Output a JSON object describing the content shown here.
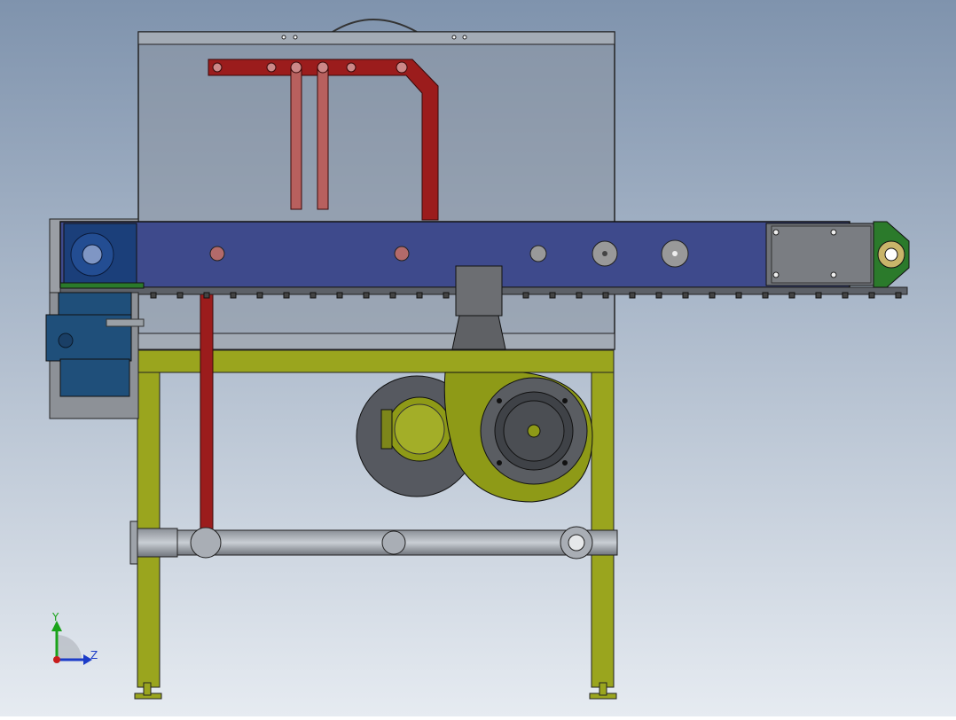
{
  "viewport": {
    "background_top": "#7f93ad",
    "background_bottom": "#e6ebf1",
    "model": {
      "frame_color": "#9aa51e",
      "conveyor_color": "#3e4a8c",
      "pipe_color": "#9b1c1c",
      "housing_color": "#8c96a3",
      "motor_color": "#1f4f7a",
      "fan_color": "#8e9a17",
      "bearing_color": "#2b7a2b"
    },
    "triad": {
      "y_label": "Y",
      "z_label": "Z",
      "y_color": "#1aa31a",
      "z_color": "#1c3cc8",
      "x_color": "#c81c1c"
    }
  }
}
